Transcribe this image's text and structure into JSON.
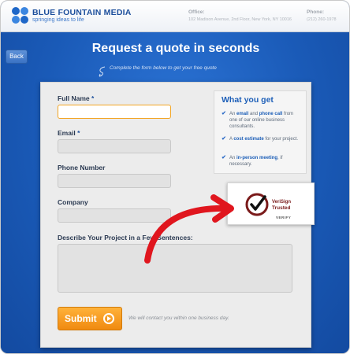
{
  "header": {
    "brand": "BLUE FOUNTAIN MEDIA",
    "tagline": "springing ideas to life",
    "office_label": "Office:",
    "office_address": "102 Madison Avenue, 2nd Floor, New York, NY 10016",
    "phone_label": "Phone:",
    "phone_number": "(212) 260-1978"
  },
  "nav": {
    "back_label": "Back"
  },
  "page": {
    "title": "Request a quote in seconds",
    "subtitle": "Complete the form below to get your free quote"
  },
  "form": {
    "full_name_label": "Full Name",
    "email_label": "Email",
    "phone_label": "Phone Number",
    "company_label": "Company",
    "required_marker": "*",
    "description_label": "Describe Your Project in a Few Sentences:",
    "full_name_value": "",
    "email_value": "",
    "phone_value": "",
    "company_value": "",
    "description_value": "",
    "submit_label": "Submit",
    "contact_note": "We will contact you within one business day."
  },
  "what_you_get": {
    "title": "What you get",
    "items": [
      {
        "pre": "An ",
        "hl1": "email",
        "mid": " and ",
        "hl2": "phone call",
        "post": " from one of our online business consultants."
      },
      {
        "pre": "A ",
        "hl1": "cost estimate",
        "post": " for your project."
      },
      {
        "pre": "An ",
        "hl1": "in-person meeting",
        "post": ", if necessary."
      }
    ]
  },
  "badge": {
    "brand": "VeriSign",
    "trusted": "Trusted",
    "verify": "VERIFY"
  },
  "colors": {
    "brand_blue": "#1a5ab7",
    "accent_orange": "#f08a10",
    "arrow_red": "#e0161e"
  },
  "icons": [
    "logo-dots-icon",
    "squiggle-arrow-icon",
    "check-icon",
    "verisign-seal-icon",
    "play-circle-icon",
    "red-curved-arrow-icon"
  ]
}
